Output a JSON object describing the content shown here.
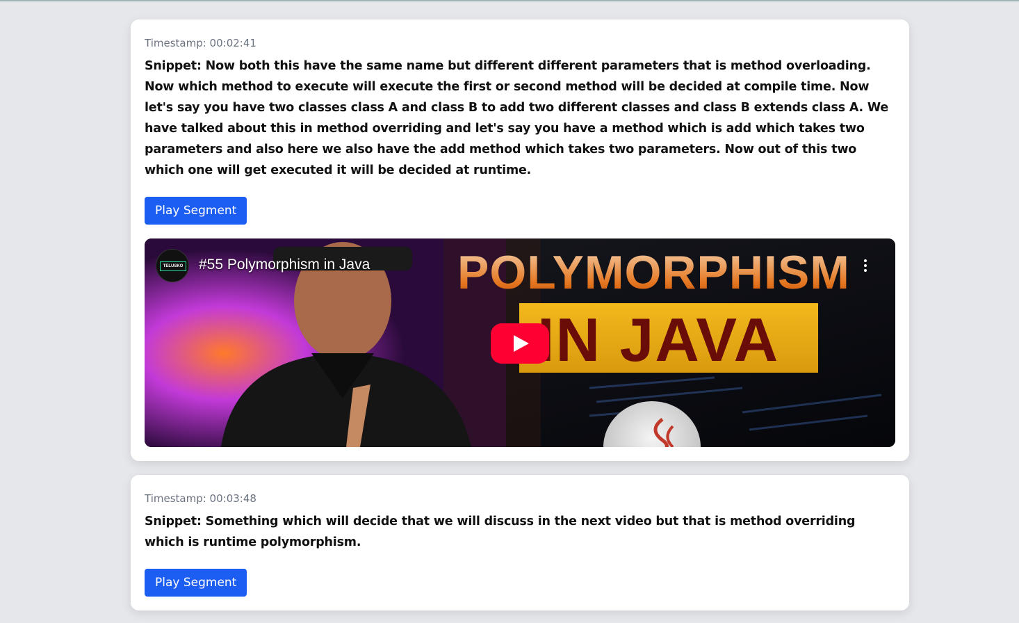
{
  "segments": [
    {
      "timestamp": "Timestamp: 00:02:41",
      "snippet": "Snippet: Now both this have the same name but different different parameters that is method overloading. Now which method to execute will execute the first or second method will be decided at compile time. Now let's say you have two classes class A and class B to add two different classes and class B extends class A. We have talked about this in method overriding and let's say you have a method which is add which takes two parameters and also here we also have the add method which takes two parameters. Now out of this two which one will get executed it will be decided at runtime.",
      "button_label": "Play Segment",
      "video": {
        "title": "#55 Polymorphism in Java",
        "channel_badge": "TELUSKO",
        "thumb_line1": "POLYMORPHISM",
        "thumb_line2": "IN JAVA",
        "play_icon": "youtube-play-icon",
        "menu_icon": "kebab-menu-icon"
      }
    },
    {
      "timestamp": "Timestamp: 00:03:48",
      "snippet": "Snippet: Something which will decide that we will discuss in the next video but that is method overriding which is runtime polymorphism.",
      "button_label": "Play Segment"
    }
  ],
  "colors": {
    "page_bg": "#e5e7eb",
    "button_bg": "#1d5ef2",
    "timestamp_text": "#6b7280",
    "youtube_red": "#ff0033"
  }
}
